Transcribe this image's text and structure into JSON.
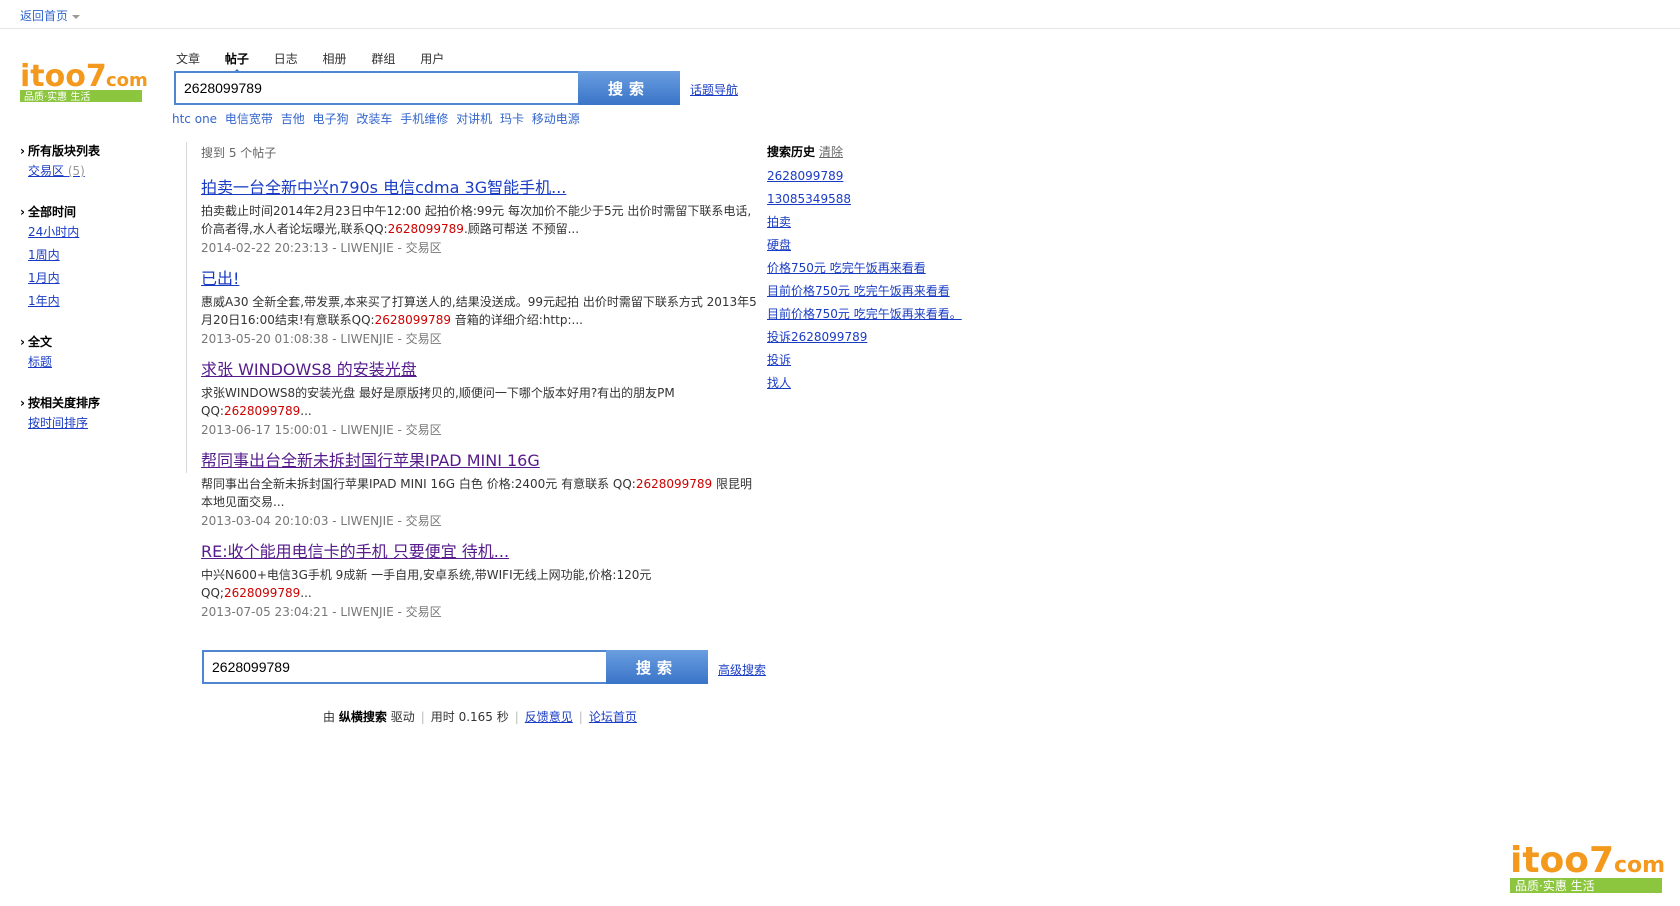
{
  "topbar": {
    "back_label": "返回首页"
  },
  "logo": {
    "main": "itoo7",
    "suffix": "com",
    "tagline": "品质·实惠 生活"
  },
  "search": {
    "tabs": [
      "文章",
      "帖子",
      "日志",
      "相册",
      "群组",
      "用户"
    ],
    "active_tab": "帖子",
    "query": "2628099789",
    "button_label": "搜索",
    "topic_nav_label": "话题导航",
    "hot_words": [
      "htc one",
      "电信宽带",
      "吉他",
      "电子狗",
      "改装车",
      "手机维修",
      "对讲机",
      "玛卡",
      "移动电源"
    ]
  },
  "sidebar": {
    "groups": [
      {
        "title": "所有版块列表",
        "items": [
          {
            "label": "交易区",
            "count": "(5)"
          }
        ]
      },
      {
        "title": "全部时间",
        "items": [
          {
            "label": "24小时内"
          },
          {
            "label": "1周内"
          },
          {
            "label": "1月内"
          },
          {
            "label": "1年内"
          }
        ]
      },
      {
        "title": "全文",
        "items": [
          {
            "label": "标题"
          }
        ]
      },
      {
        "title": "按相关度排序",
        "items": [
          {
            "label": "按时间排序"
          }
        ]
      }
    ]
  },
  "results": {
    "count_text": "搜到 5 个帖子",
    "items": [
      {
        "title": "拍卖一台全新中兴n790s 电信cdma 3G智能手机...",
        "snippet_pre": "拍卖截止时间2014年2月23日中午12:00 起拍价格:99元 每次加价不能少于5元 出价时需留下联系电话,价高者得,水人者论坛曝光,联系QQ:",
        "snippet_hl": "2628099789",
        "snippet_post": ".顾路可帮送 不预留...",
        "meta": "2014-02-22 20:23:13 - LIWENJIE - 交易区"
      },
      {
        "title": "已出!",
        "snippet_pre": "惠威A30 全新全套,带发票,本来买了打算送人的,结果没送成。99元起拍 出价时需留下联系方式 2013年5月20日16:00结束!有意联系QQ:",
        "snippet_hl": "2628099789",
        "snippet_post": " 音箱的详细介绍:http:...",
        "meta": "2013-05-20 01:08:38 - LIWENJIE - 交易区"
      },
      {
        "title": "求张 WINDOWS8 的安装光盘",
        "snippet_pre": "求张WINDOWS8的安装光盘 最好是原版拷贝的,顺便问一下哪个版本好用?有出的朋友PM QQ:",
        "snippet_hl": "2628099789",
        "snippet_post": "...",
        "meta": "2013-06-17 15:00:01 - LIWENJIE - 交易区"
      },
      {
        "title": "帮同事出台全新未拆封国行苹果IPAD MINI 16G",
        "snippet_pre": "帮同事出台全新未拆封国行苹果IPAD MINI 16G 白色 价格:2400元 有意联系 QQ:",
        "snippet_hl": "2628099789",
        "snippet_post": " 限昆明本地见面交易...",
        "meta": "2013-03-04 20:10:03 - LIWENJIE - 交易区"
      },
      {
        "title": "RE:收个能用电信卡的手机 只要便宜 待机...",
        "snippet_pre": "中兴N600+电信3G手机 9成新 一手自用,安卓系统,带WIFI无线上网功能,价格:120元 QQ;",
        "snippet_hl": "2628099789",
        "snippet_post": "...",
        "meta": "2013-07-05 23:04:21 - LIWENJIE - 交易区"
      }
    ]
  },
  "bottom_search": {
    "query": "2628099789",
    "button_label": "搜索",
    "advanced_label": "高级搜索"
  },
  "footer": {
    "powered_pre": "由",
    "powered_brand": "纵横搜索",
    "powered_post": "驱动",
    "time_text": "用时 0.165 秒",
    "feedback": "反馈意见",
    "home": "论坛首页"
  },
  "history": {
    "title": "搜索历史",
    "clear_label": "清除",
    "items": [
      "2628099789",
      "13085349588",
      "拍卖",
      "硬盘",
      "价格750元 吃完午饭再来看看",
      "目前价格750元 吃完午饭再来看看",
      "目前价格750元 吃完午饭再来看看。",
      "投诉2628099789",
      "投诉",
      "找人"
    ]
  },
  "colors": {
    "link": "#1a3cc4",
    "highlight": "#cc0000",
    "button": "#3a74c8",
    "logo_orange": "#f39a1e",
    "logo_green": "#8cc63f"
  }
}
